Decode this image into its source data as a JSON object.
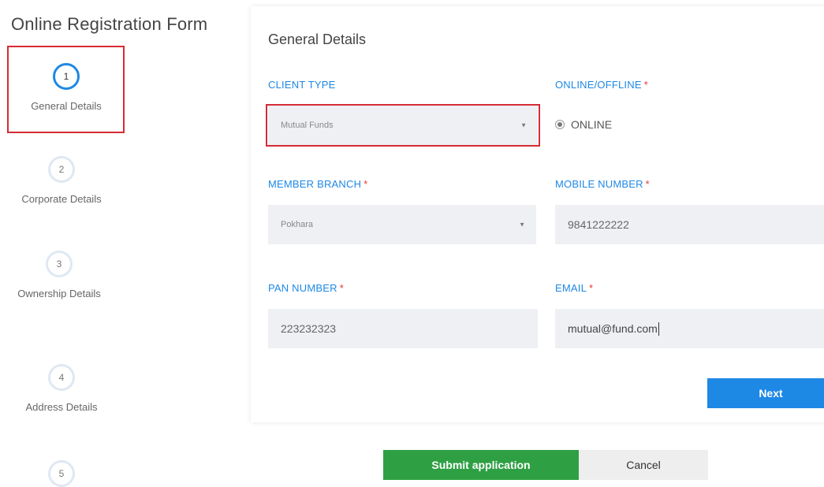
{
  "page": {
    "title": "Online Registration Form"
  },
  "steps": [
    {
      "number": "1",
      "label": "General Details",
      "active": true
    },
    {
      "number": "2",
      "label": "Corporate Details",
      "active": false
    },
    {
      "number": "3",
      "label": "Ownership Details",
      "active": false
    },
    {
      "number": "4",
      "label": "Address Details",
      "active": false
    },
    {
      "number": "5",
      "label": "",
      "active": false
    }
  ],
  "form": {
    "title": "General Details",
    "client_type": {
      "label": "CLIENT TYPE",
      "value": "Mutual Funds"
    },
    "online_offline": {
      "label": "ONLINE/OFFLINE",
      "required": "*",
      "option": "ONLINE"
    },
    "member_branch": {
      "label": "MEMBER BRANCH",
      "required": "*",
      "value": "Pokhara"
    },
    "mobile_number": {
      "label": "MOBILE NUMBER",
      "required": "*",
      "value": "9841222222"
    },
    "pan_number": {
      "label": "PAN NUMBER",
      "required": "*",
      "value": "223232323"
    },
    "email": {
      "label": "EMAIL",
      "required": "*",
      "value": "mutual@fund.com"
    },
    "next_label": "Next"
  },
  "actions": {
    "submit_label": "Submit application",
    "cancel_label": "Cancel"
  },
  "colors": {
    "accent": "#1e88e5",
    "submit": "#2ea043",
    "highlight": "#d62b35",
    "required": "#e53935"
  },
  "icons": {
    "select_caret": "caret-down-icon",
    "radio": "radio-selected-icon"
  }
}
